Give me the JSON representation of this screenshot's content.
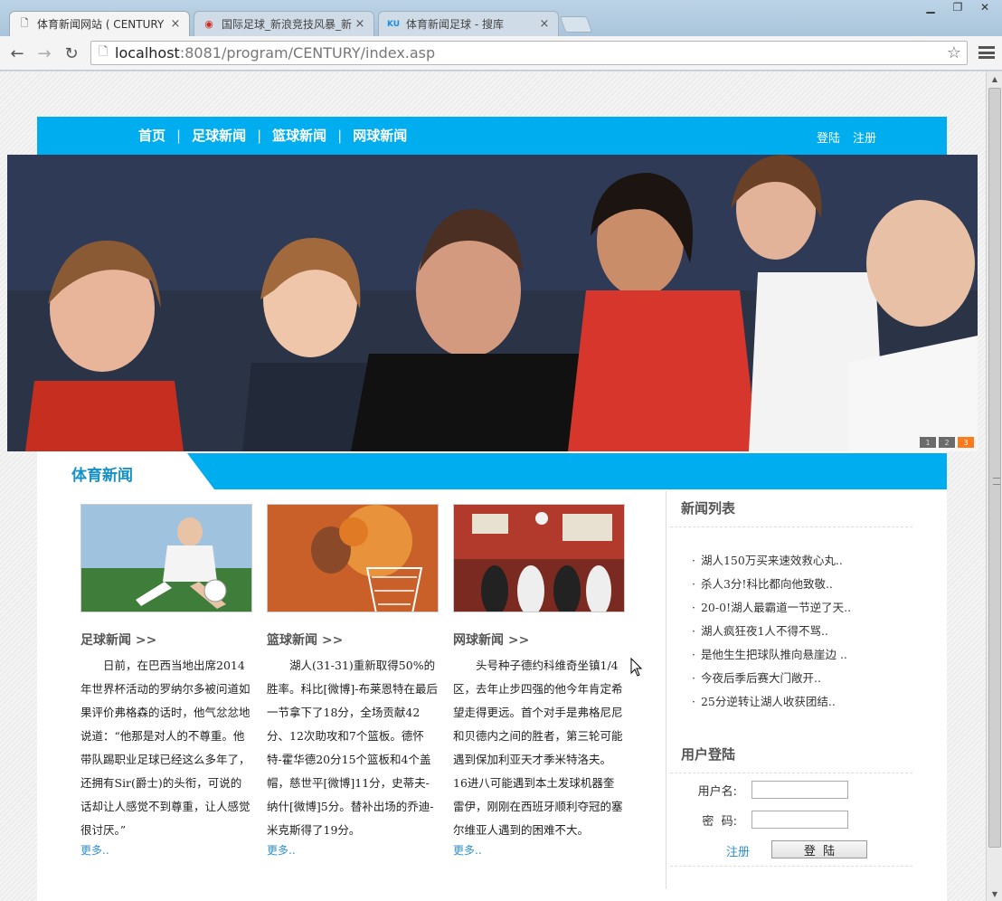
{
  "browser": {
    "tabs": [
      {
        "title": "体育新闻网站 ( CENTURY",
        "active": true
      },
      {
        "title": "国际足球_新浪竞技风暴_新",
        "active": false
      },
      {
        "title": "体育新闻足球 - 搜库",
        "active": false
      }
    ],
    "url_host": "localhost",
    "url_port": ":8081",
    "url_path": "/program/CENTURY/index.asp"
  },
  "nav": {
    "links": [
      "首页",
      "足球新闻",
      "篮球新闻",
      "网球新闻"
    ],
    "separator": "|",
    "login": "登陆",
    "register": "注册"
  },
  "banner": {
    "dots": [
      "1",
      "2",
      "3"
    ],
    "active_dot": 3
  },
  "section": {
    "title": "体育新闻"
  },
  "columns": [
    {
      "title": "足球新闻 >>",
      "body": "日前，在巴西当地出席2014年世界杯活动的罗纳尔多被问道如果评价弗格森的话时，他气忿忿地说道：“他那是对人的不尊重。他带队踢职业足球已经这么多年了，还拥有Sir(爵士)的头衔，可说的话却让人感觉不到尊重，让人感觉很讨厌。”",
      "more": "更多.."
    },
    {
      "title": "篮球新闻 >>",
      "body": "湖人(31-31)重新取得50%的胜率。科比[微博]-布莱恩特在最后一节拿下了18分，全场贡献42分、12次助攻和7个篮板。德怀特-霍华德20分15个篮板和4个盖帽，慈世平[微博]11分，史蒂夫-纳什[微博]5分。替补出场的乔迪-米克斯得了19分。",
      "more": "更多.."
    },
    {
      "title": "网球新闻 >>",
      "body": "头号种子德约科维奇坐镇1/4区，去年止步四强的他今年肯定希望走得更远。首个对手是弗格尼尼和贝德内之间的胜者，第三轮可能遇到保加利亚天才季米特洛夫。16进八可能遇到本土发球机器奎雷伊，刚刚在西班牙顺利夺冠的塞尔维亚人遇到的困难不大。",
      "more": "更多.."
    }
  ],
  "news_list": {
    "title": "新闻列表",
    "items": [
      "湖人150万买来速效救心丸..",
      "杀人3分!科比都向他致敬..",
      "20-0!湖人最霸道一节逆了天..",
      "湖人疯狂夜1人不得不骂..",
      "是他生生把球队推向悬崖边 ..",
      "今夜后季后赛大门敞开..",
      "25分逆转让湖人收获团结.."
    ]
  },
  "login": {
    "title": "用户登陆",
    "username_label": "用户名:",
    "password_label": "密  码:",
    "register_link": "注册",
    "submit_label": "登  陆"
  },
  "colors": {
    "accent": "#00aef0",
    "section_title": "#1591c9",
    "link": "#2f8fd1",
    "active_dot": "#ff7a1a"
  }
}
